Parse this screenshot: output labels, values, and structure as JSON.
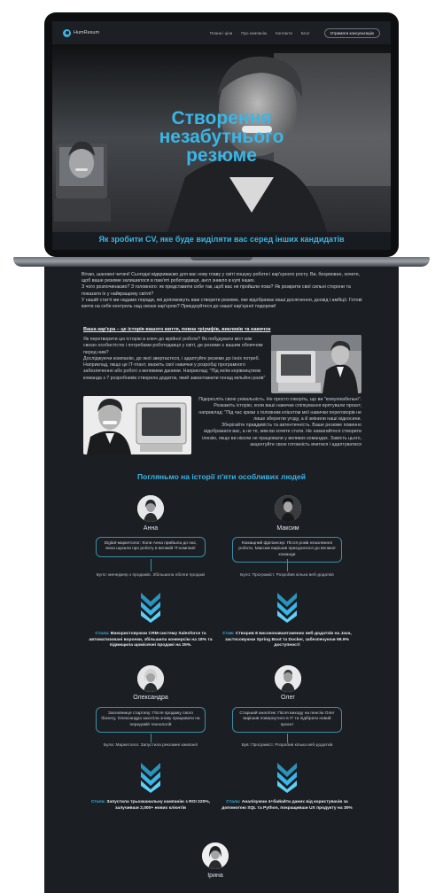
{
  "nav": {
    "logo": "HumResum",
    "links": [
      "Плани і ціни",
      "Про компанію",
      "Контакти",
      "Блог"
    ],
    "cta": "Отримати консультацію"
  },
  "hero": {
    "title": "Створення\nнезабутнього\nрезюме",
    "subtitle": "Як зробити CV, яке буде виділяти вас серед інших кандидатів"
  },
  "intro": [
    "Вітаю, шановні читачі! Сьогодні відкриваємо для вас нову главу у світі пошуку роботи і кар'єрного росту. Ви, безумовно, хочете, щоб ваше резюме залишилося в пам'яті роботодавця, англ зникло в купі інших.",
    "З чого розпочинаємо? З головного: як представити себе так, щоб вас не пройшли повз? Як розкрити свої сильні сторони та показати їх у найкращому світлі?",
    "У нашій статті ми надамо поради, які допоможуть вам створити резюме, яке відображає ваші досягнення, досвід і амбіції. Готові взяти на себе контроль над своєю кар'єрою? Приєднуйтеся до нашої кар'єрної подорожі!"
  ],
  "subheading": "Ваша кар'єра – це історія вашого життя, повна тріумфів, викликів та навичок",
  "para1": [
    "Як перетворити цю історію в ключ до мрійної роботи? Як побудувати міст між своєю особистістю і потребами роботодавця у світі, де резюме є вашим обличчям перед ним?",
    "Досліджуючи компанію, до якої звертаєтеся, і адаптуйте резюме до їхніх потреб. Наприклад, якщо це IT-гігант, вкажіть свої навички у розробці програмного забезпечення або роботі з великими даними. Наприклад: \"Під моїм керівництвом команда з 7 розробників створила додаток, який завантажили понад мільйон разів\""
  ],
  "para2": [
    "Підкресліть свою унікальність. Не просто говоріть, що ви \"комунікабельні\". Розкажіть історію, коли ваші навички спілкування врятували проєкт, наприклад: \"Під час кризи з головним клієнтом мої навички переговорів не лише зберегли угоду, а й змінили наші відносини.",
    "Зберігайте правдивість та автентичність. Ваше резюме повинно відображати вас, а не те, ким ви хочете стати. Не намагайтеся створити ілюзію, якщо ви ніколи не працювали у великих командах. Замість цього, акцентуйте свою готовність вчитися і адаптуватися"
  ],
  "section_title": "Погляньмо на історії п'яти особливих людей",
  "people": [
    {
      "name": "Анна",
      "story": "Digital-маркетолог: Коли Анна прийшла до нас, вона шукала про роботу в великій IT-компанії",
      "dots": "Було: менеджер з продажів. Збільшила обсяги продажі",
      "label": "Стала:",
      "outcome": "Використовуючи CRM-систему Salesforce та автоматизовані воронки, збільшила конверсію на 18% та підвищила щомісячні продажі на 25%."
    },
    {
      "name": "Максим",
      "story": "Комащний фрілансер: Після років незалежної роботи, Максим вирішив приєднатися до великої команди",
      "dots": "Було: Програміст. Розробив кілька веб-додатків",
      "label": "Став:",
      "outcome": "Створив 8 високонавантажених веб-додатків на Java, застосовуючи Spring Boot та Docker, забезпечуючи 99.9% доступності"
    },
    {
      "name": "Олександра",
      "story": "Засновниця стартапу: Після продажу свого бізнесу, Олександра захотіла знову працювати на передовій технологій",
      "dots": "Була: Маркетолог. Запустила рекламні кампанії",
      "label": "Стала:",
      "outcome": "Запустила трьохканальну кампанію з ROI 220%, залучивши 2,000+ нових клієнтів"
    },
    {
      "name": "Олег",
      "story": "Старший аналітик: Після виходу на пенсію Олег вирішив повернутися в IT та підібрати новий проєкт",
      "dots": "Був: Програміст. Розробив кілька веб-додатків",
      "label": "Стала:",
      "outcome": "Аналізуючи 4+байайти даних від користувачів за допомогою SQL та Python, покращивши UX продукту на 30%"
    }
  ],
  "next_person": {
    "name": "Ірина"
  },
  "colors": {
    "accent": "#39b6e8",
    "page_bg": "#1b1e23",
    "text": "#cdd4db"
  }
}
